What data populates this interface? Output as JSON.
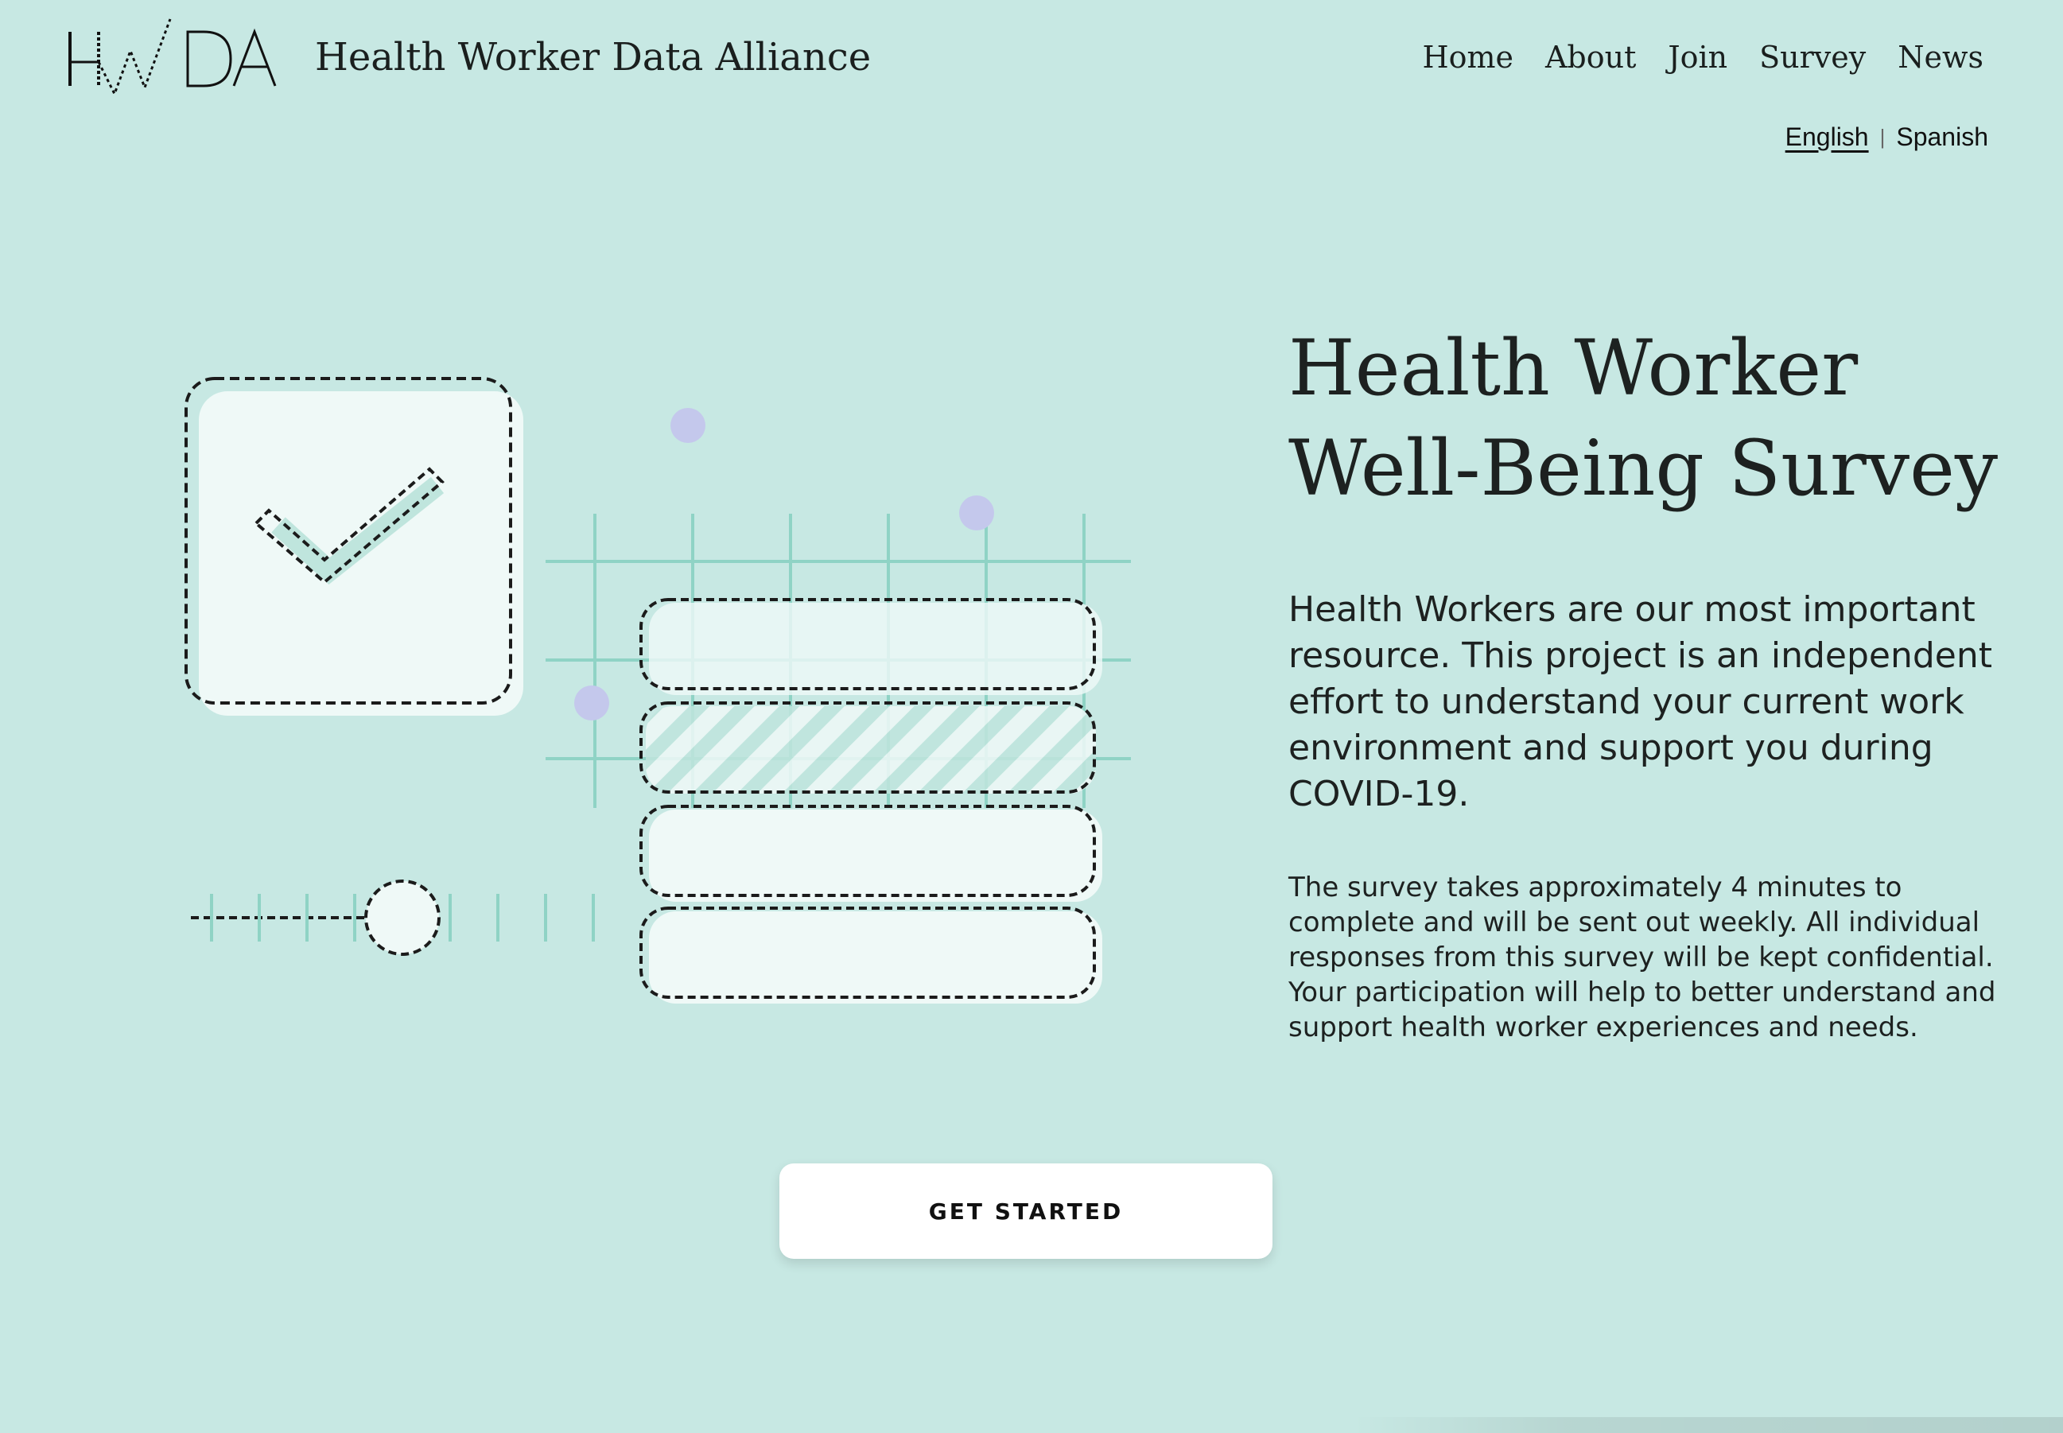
{
  "brand": {
    "logo_text": "HWDA",
    "site_name": "Health Worker Data Alliance"
  },
  "nav": {
    "items": [
      {
        "label": "Home"
      },
      {
        "label": "About"
      },
      {
        "label": "Join"
      },
      {
        "label": "Survey"
      },
      {
        "label": "News"
      }
    ]
  },
  "language": {
    "english": "English",
    "separator": "|",
    "spanish": "Spanish",
    "active": "English"
  },
  "hero": {
    "title_line1": "Health Worker",
    "title_line2": "Well-Being Survey",
    "lead": "Health Workers are our most important resource. This project is an independent effort to understand your current work environment and support you during COVID-19.",
    "body": "The survey takes approximately 4 minutes to complete and will be sent out weekly. All individual responses from this survey will be kept confidential. Your participation will help to better understand and support health worker experiences and needs.",
    "cta_label": "GET STARTED"
  },
  "colors": {
    "background": "#c7e8e3",
    "card_fill": "#eff9f7",
    "grid_teal": "#8fd3c5",
    "dot_lavender": "#c4c8ec",
    "text": "#1d2120"
  },
  "icons": [
    "hwda-logo",
    "checkbox-illustration-icon",
    "checkmark-icon",
    "slider-illustration-icon",
    "list-illustration-icon"
  ]
}
